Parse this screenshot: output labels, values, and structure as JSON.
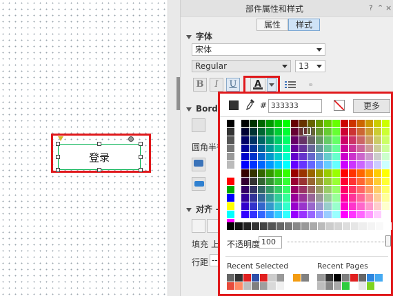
{
  "canvas": {
    "widget_label": "登录"
  },
  "panel": {
    "title": "部件属性和样式",
    "header_icons": [
      "?",
      "⌃",
      "×"
    ],
    "tabs": [
      {
        "label": "属性",
        "active": false
      },
      {
        "label": "样式",
        "active": true
      }
    ]
  },
  "font": {
    "section_label": "字体",
    "family": "宋体",
    "style": "Regular",
    "size": "13",
    "bold": "B",
    "italic": "I",
    "underline": "U",
    "color_letter": "A"
  },
  "border": {
    "section_label": "Borde",
    "radius_label": "圆角半径"
  },
  "align": {
    "section_label": "对齐 +",
    "fill_label": "填充",
    "fill_value": "上",
    "line_label": "行距",
    "line_value": "--"
  },
  "picker": {
    "hex_value": "333333",
    "more_label": "更多",
    "opacity_label": "不透明度",
    "opacity_value": "100",
    "recent_selected_label": "Recent Selected",
    "recent_pages_label": "Recent Pages",
    "current_color": "#333333",
    "left_column": [
      "#000000",
      "#333333",
      "#555555",
      "#777777",
      "#999999",
      "#bbbbbb",
      "#ffffff",
      "#ff0000",
      "#00aa00",
      "#0000ff",
      "#ffff00",
      "#00ffff",
      "#ff00ff"
    ],
    "grays": [
      "#000000",
      "#111111",
      "#222222",
      "#333333",
      "#444444",
      "#555555",
      "#666666",
      "#777777",
      "#888888",
      "#999999",
      "#aaaaaa",
      "#bbbbbb",
      "#cccccc",
      "#d4d4d4",
      "#dddddd",
      "#e6e6e6",
      "#eeeeee",
      "#f4f4f4",
      "#f9f9f9",
      "#ffffff"
    ],
    "recent_selected": [
      "#666666",
      "#333333",
      "#e02020",
      "#2e4ea8",
      "#e02020",
      "#cccccc",
      "#999999",
      "#ffffff",
      "#e74c3c",
      "#ff8a65",
      "#bdbdbd",
      "#7f7f7f",
      "#9e9e9e",
      "#d9d9d9",
      "#f0f0f0",
      "#ffffff"
    ],
    "recent_selected_orange": [
      "#f39c12",
      "#808080"
    ],
    "recent_pages": [
      "#999999",
      "#333333",
      "#000000",
      "#7f7f7f",
      "#e02020",
      "#666666",
      "#2e86de",
      "#45aaf2",
      "#bdbdbd",
      "#888888",
      "#aaaaaa",
      "#2ecc40",
      "#ffffff",
      "#e6e6e6",
      "#7ed321",
      "#ffffff"
    ]
  }
}
